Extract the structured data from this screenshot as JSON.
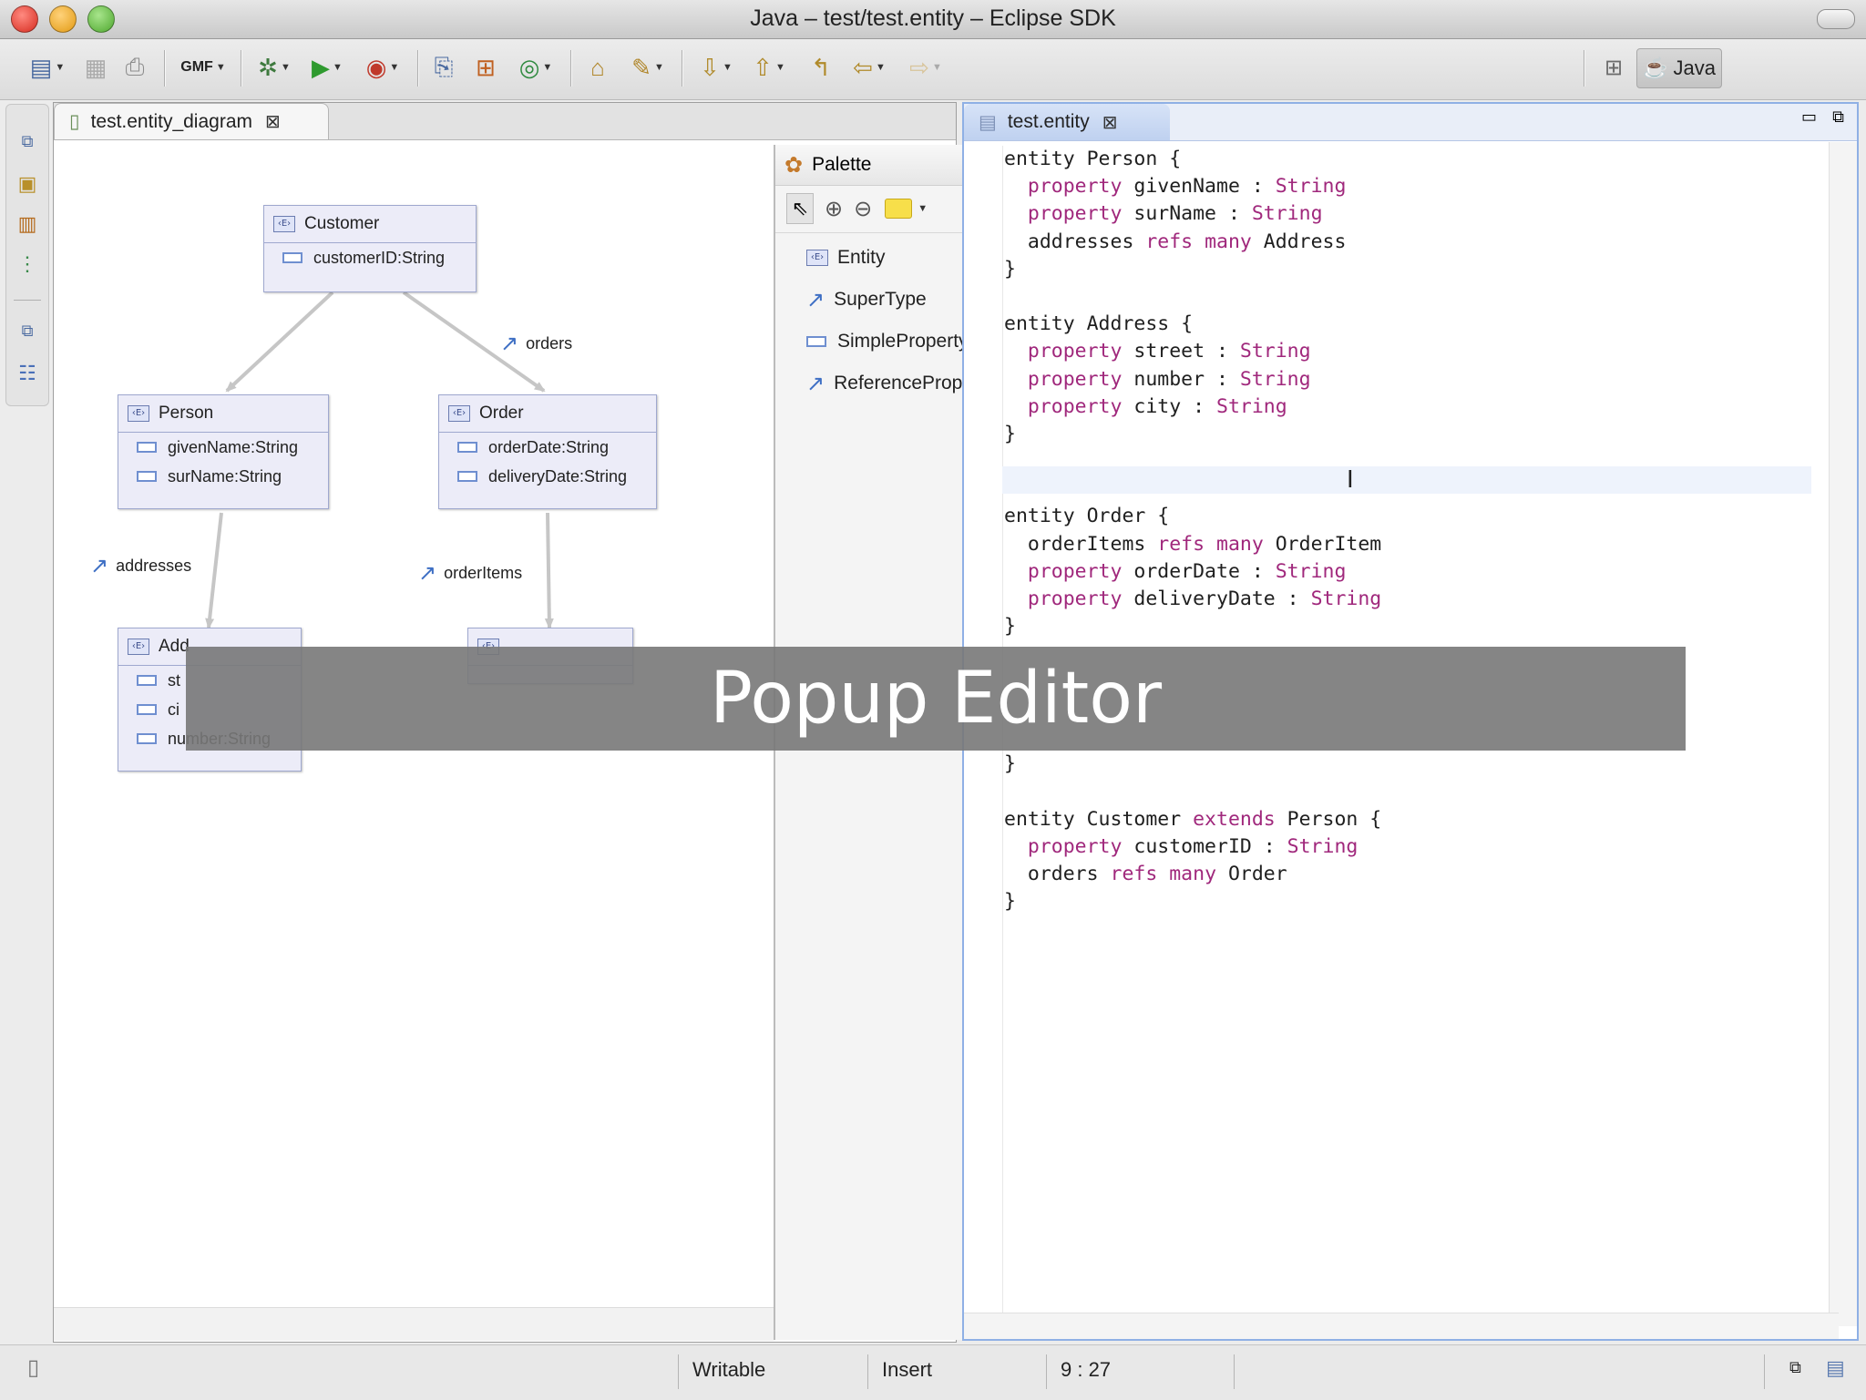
{
  "window": {
    "title": "Java – test/test.entity – Eclipse SDK"
  },
  "toolbar": {
    "gmf_label": "GMF",
    "perspective_label": "Java"
  },
  "left_editor": {
    "tab_label": "test.entity_diagram",
    "nodes": {
      "customer": {
        "name": "Customer",
        "props": [
          "customerID:String"
        ]
      },
      "person": {
        "name": "Person",
        "props": [
          "givenName:String",
          "surName:String"
        ]
      },
      "order": {
        "name": "Order",
        "props": [
          "orderDate:String",
          "deliveryDate:String"
        ]
      },
      "address": {
        "name": "Add",
        "props": [
          "st",
          "ci",
          "number:String"
        ]
      },
      "orderitem": {
        "name": ""
      }
    },
    "edges": {
      "orders": "orders",
      "addresses": "addresses",
      "order_items": "orderItems"
    },
    "palette": {
      "title": "Palette",
      "items": [
        "Entity",
        "SuperType",
        "SimpleProperty",
        "ReferenceProp..."
      ]
    }
  },
  "right_editor": {
    "tab_label": "test.entity",
    "code_lines": [
      [
        [
          "entity Person {",
          ""
        ]
      ],
      [
        [
          "  ",
          ""
        ],
        [
          "property",
          "kw"
        ],
        [
          " givenName : ",
          ""
        ],
        [
          "String",
          "kw"
        ]
      ],
      [
        [
          "  ",
          ""
        ],
        [
          "property",
          "kw"
        ],
        [
          " surName : ",
          ""
        ],
        [
          "String",
          "kw"
        ]
      ],
      [
        [
          "  addresses ",
          ""
        ],
        [
          "refs",
          "kw"
        ],
        [
          " ",
          ""
        ],
        [
          "many",
          "kw"
        ],
        [
          " Address",
          ""
        ]
      ],
      [
        [
          "}",
          ""
        ]
      ],
      [
        [
          "",
          ""
        ]
      ],
      [
        [
          "entity Address {",
          ""
        ]
      ],
      [
        [
          "  ",
          ""
        ],
        [
          "property",
          "kw"
        ],
        [
          " street : ",
          ""
        ],
        [
          "String",
          "kw"
        ]
      ],
      [
        [
          "  ",
          ""
        ],
        [
          "property",
          "kw"
        ],
        [
          " number : ",
          ""
        ],
        [
          "String",
          "kw"
        ]
      ],
      [
        [
          "  ",
          ""
        ],
        [
          "property",
          "kw"
        ],
        [
          " city : ",
          ""
        ],
        [
          "String",
          "kw"
        ]
      ],
      [
        [
          "}",
          ""
        ]
      ],
      [
        [
          "",
          ""
        ]
      ],
      [
        [
          "",
          ""
        ]
      ],
      [
        [
          "entity Order {",
          ""
        ]
      ],
      [
        [
          "  orderItems ",
          ""
        ],
        [
          "refs",
          "kw"
        ],
        [
          " ",
          ""
        ],
        [
          "many",
          "kw"
        ],
        [
          " OrderItem",
          ""
        ]
      ],
      [
        [
          "  ",
          ""
        ],
        [
          "property",
          "kw"
        ],
        [
          " orderDate : ",
          ""
        ],
        [
          "String",
          "kw"
        ]
      ],
      [
        [
          "  ",
          ""
        ],
        [
          "property",
          "kw"
        ],
        [
          " deliveryDate : ",
          ""
        ],
        [
          "String",
          "kw"
        ]
      ],
      [
        [
          "}",
          ""
        ]
      ],
      [
        [
          "",
          ""
        ]
      ],
      [
        [
          "",
          ""
        ]
      ],
      [
        [
          "",
          ""
        ]
      ],
      [
        [
          "",
          ""
        ]
      ],
      [
        [
          "}",
          ""
        ]
      ],
      [
        [
          "",
          ""
        ]
      ],
      [
        [
          "entity Customer ",
          ""
        ],
        [
          "extends",
          "kw"
        ],
        [
          " Person {",
          ""
        ]
      ],
      [
        [
          "  ",
          ""
        ],
        [
          "property",
          "kw"
        ],
        [
          " customerID : ",
          ""
        ],
        [
          "String",
          "kw"
        ]
      ],
      [
        [
          "  orders ",
          ""
        ],
        [
          "refs",
          "kw"
        ],
        [
          " ",
          ""
        ],
        [
          "many",
          "kw"
        ],
        [
          " Order",
          ""
        ]
      ],
      [
        [
          "}",
          ""
        ]
      ]
    ]
  },
  "overlay": {
    "caption": "Popup Editor"
  },
  "status": {
    "writable": "Writable",
    "insert_mode": "Insert",
    "cursor_position": "9 : 27"
  },
  "colors": {
    "keyword": "#a0287c",
    "node_fill": "#ececf8",
    "overlay": "#787878",
    "active_border": "#8fb0e5"
  }
}
